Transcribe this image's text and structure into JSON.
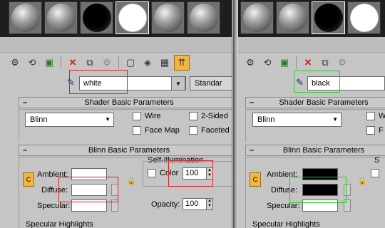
{
  "colors": {
    "highlight_red": "#e02020",
    "highlight_green": "#22d022",
    "active_button": "#f3b63c"
  },
  "left": {
    "slots": [
      "grey",
      "grey",
      "black",
      "white",
      "grey",
      "grey"
    ],
    "material_name": "white",
    "material_type": "Standar",
    "shader_rollout": "Shader Basic Parameters",
    "shader_type": "Blinn",
    "wire": "Wire",
    "two_sided": "2-Sided",
    "face_map": "Face Map",
    "faceted": "Faceted",
    "blinn_rollout": "Blinn Basic Parameters",
    "ambient": "Ambient:",
    "diffuse": "Diffuse:",
    "specular": "Specular:",
    "self_illum_title": "Self-Illumination",
    "color": "Color",
    "color_value": "100",
    "opacity": "Opacity:",
    "opacity_value": "100",
    "specular_highlights": "Specular Highlights",
    "ambient_color": "#ffffff",
    "diffuse_color": "#ffffff",
    "specular_color": "#ffffff"
  },
  "right": {
    "slots": [
      "grey",
      "grey",
      "black",
      "white"
    ],
    "material_name": "black",
    "shader_rollout": "Shader Basic Parameters",
    "shader_type": "Blinn",
    "wire": "Wi",
    "face_map": "F",
    "blinn_rollout": "Blinn Basic Parameters",
    "ambient": "Ambient:",
    "diffuse": "Diffuse:",
    "specular": "Specular:",
    "self_illum_title": "S",
    "specular_highlights": "Specular Highlights",
    "ambient_color": "#000000",
    "diffuse_color": "#000000",
    "specular_color": "#ffffff"
  },
  "toolbar_icons": [
    "get-material-icon",
    "put-to-scene-icon",
    "assign-material-icon",
    "reset-icon",
    "make-copy-icon",
    "make-unique-icon",
    "put-to-library-icon",
    "material-id-icon",
    "show-map-icon",
    "show-end-result-icon"
  ]
}
